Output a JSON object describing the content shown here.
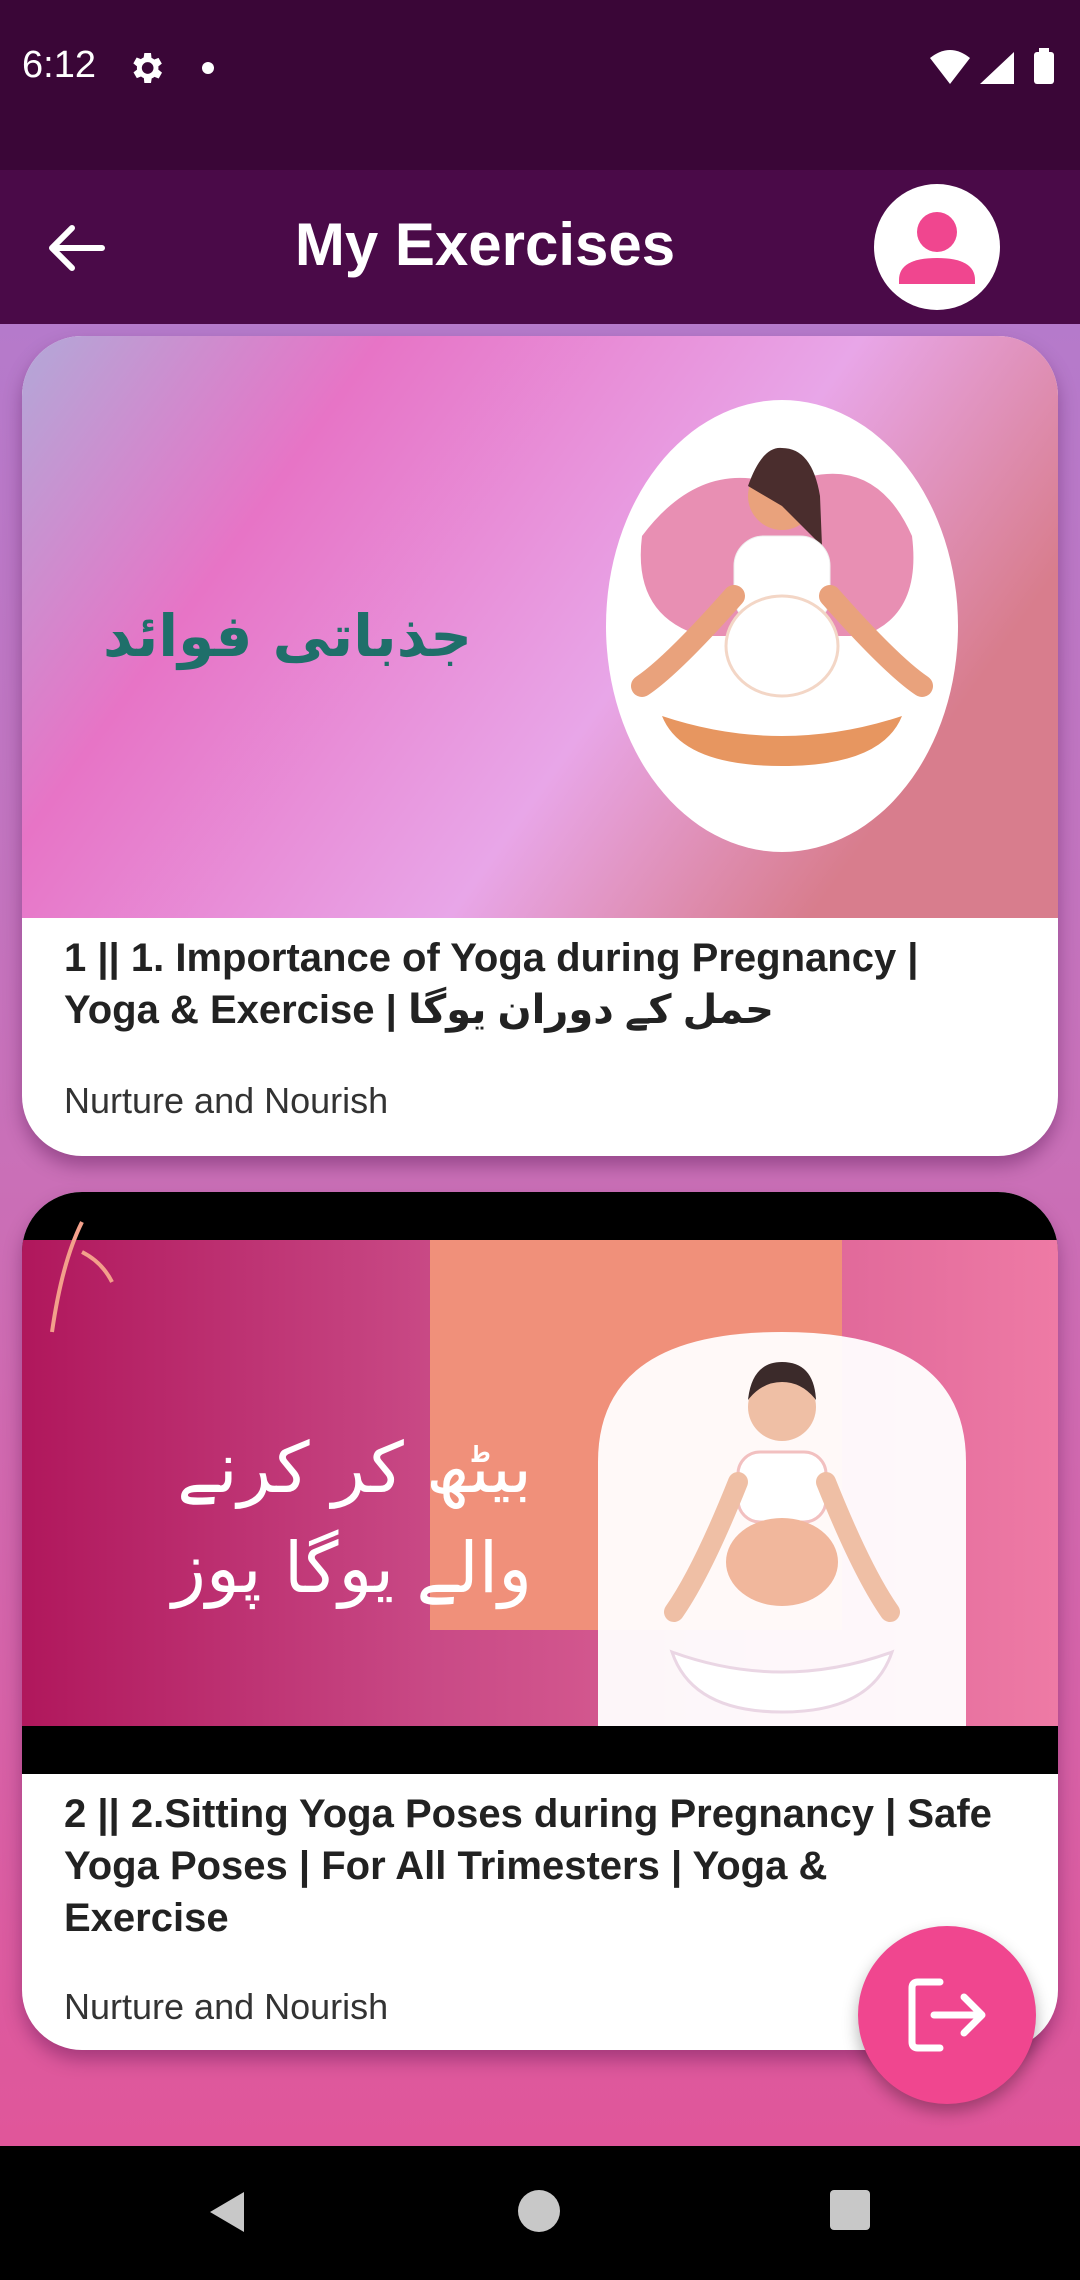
{
  "status_bar": {
    "time": "6:12"
  },
  "app_bar": {
    "title": "My Exercises"
  },
  "exercises": [
    {
      "thumb_text": "جذباتی فوائد",
      "title": "1 || 1. Importance of Yoga during Pregnancy | Yoga & Exercise | حمل کے دوران یوگا",
      "channel": "Nurture and Nourish"
    },
    {
      "thumb_text_line1": "بیٹھ کر کرنے",
      "thumb_text_line2": "والے یوگا پوز",
      "title": "2 || 2.Sitting Yoga Poses during Pregnancy | Safe Yoga Poses | For All Trimesters | Yoga & Exercise",
      "channel": "Nurture and Nourish"
    }
  ],
  "colors": {
    "status_bar": "#3a0637",
    "app_bar": "#4a0a48",
    "fab": "#f0468f",
    "avatar_icon": "#f0468f"
  },
  "icons": {
    "back": "arrow-left-icon",
    "avatar": "person-icon",
    "fab": "logout-icon"
  }
}
